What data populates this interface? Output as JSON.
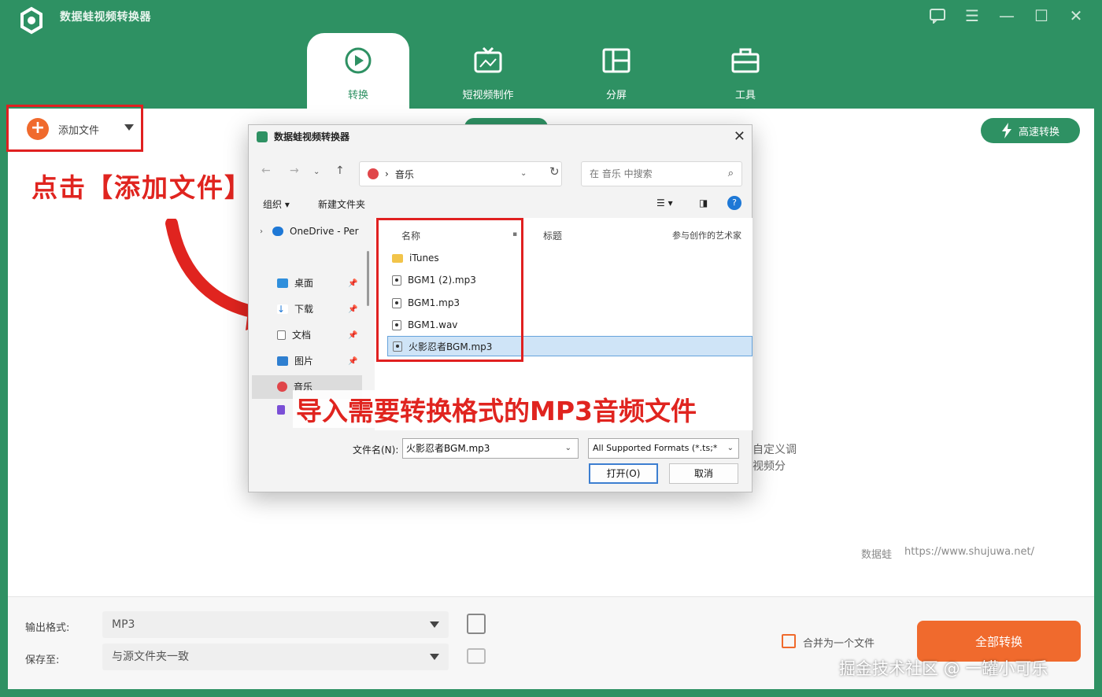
{
  "app": {
    "title": "数据蛙视频转换器",
    "tabs": [
      {
        "label": "转换",
        "icon": "convert-icon",
        "active": true
      },
      {
        "label": "短视频制作",
        "icon": "tv-icon",
        "active": false
      },
      {
        "label": "分屏",
        "icon": "split-screen-icon",
        "active": false
      },
      {
        "label": "工具",
        "icon": "toolbox-icon",
        "active": false
      }
    ],
    "colors": {
      "primary": "#2e9163",
      "accent": "#f06a2d",
      "annotation": "#e0241f"
    }
  },
  "toolbar": {
    "add_file_label": "添加文件",
    "speed_convert_label": "高速转换"
  },
  "annotations": {
    "step1": "点击【添加文件】",
    "step2": "导入需要转换格式的MP3音频文件"
  },
  "dialog": {
    "title": "数据蛙视频转换器",
    "address": "音乐",
    "search_placeholder": "在 音乐 中搜索",
    "organize_label": "组织",
    "new_folder_label": "新建文件夹",
    "nav_items": [
      {
        "label": "OneDrive - Per",
        "icon": "cloud-icon"
      },
      {
        "label": "桌面",
        "icon": "desktop-icon"
      },
      {
        "label": "下载",
        "icon": "download-icon"
      },
      {
        "label": "文档",
        "icon": "document-icon"
      },
      {
        "label": "图片",
        "icon": "picture-icon"
      },
      {
        "label": "音乐",
        "icon": "music-icon"
      }
    ],
    "columns": {
      "name": "名称",
      "title": "标题",
      "artist": "参与创作的艺术家"
    },
    "files": [
      {
        "name": "iTunes",
        "type": "folder"
      },
      {
        "name": "BGM1 (2).mp3",
        "type": "audio"
      },
      {
        "name": "BGM1.mp3",
        "type": "audio"
      },
      {
        "name": "BGM1.wav",
        "type": "audio"
      },
      {
        "name": "火影忍者BGM.mp3",
        "type": "audio",
        "selected": true
      }
    ],
    "filename_label": "文件名(N):",
    "filename_value": "火影忍者BGM.mp3",
    "filetype_value": "All Supported Formats (*.ts;*",
    "open_label": "打开(O)",
    "cancel_label": "取消"
  },
  "behind_dialog_text": [
    "自定义调",
    "视频分"
  ],
  "watermark": {
    "brand": "数据蛙",
    "url": "https://www.shujuwa.net/"
  },
  "bottom": {
    "output_format_label": "输出格式:",
    "output_format_value": "MP3",
    "save_to_label": "保存至:",
    "save_to_value": "与源文件夹一致",
    "merge_label": "合并为一个文件",
    "convert_all_label": "全部转换"
  },
  "credit": "掘金技术社区 @ 一罐小可乐"
}
